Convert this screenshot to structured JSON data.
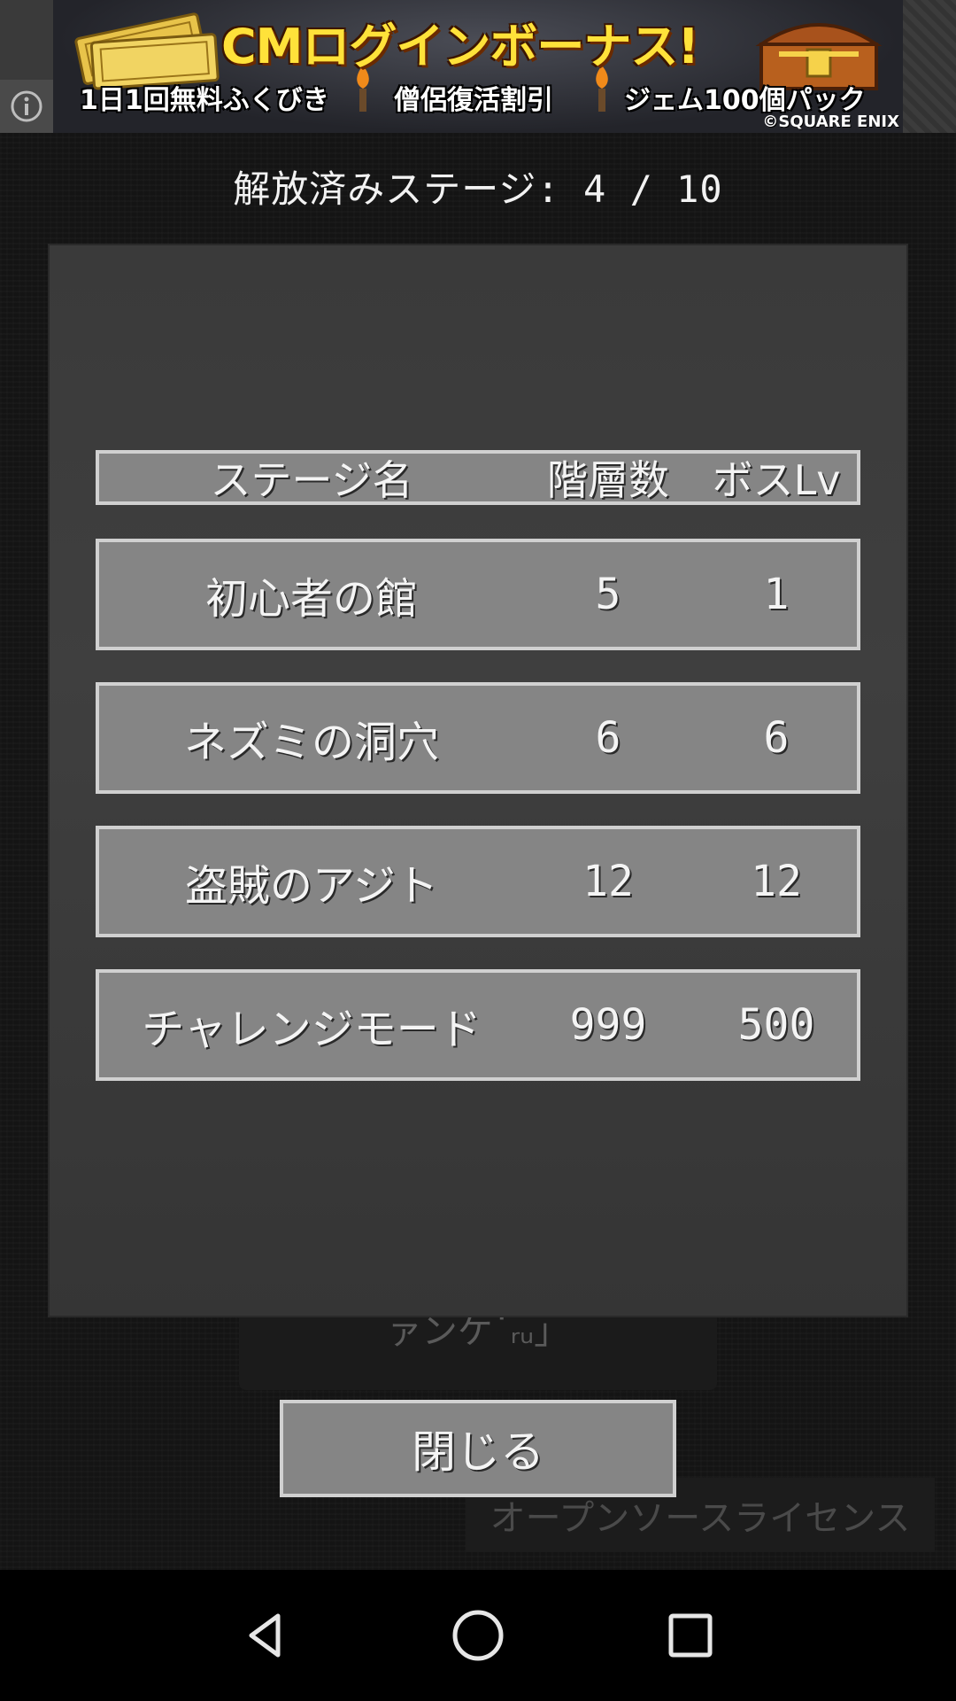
{
  "ad": {
    "title": "CMログインボーナス!",
    "items": [
      "1日1回無料ふくびき",
      "僧侶復活割引",
      "ジェム100個パック"
    ],
    "copyright": "©SQUARE ENIX",
    "info_icon": "info-icon"
  },
  "header": {
    "unlocked_label": "解放済みステージ: 4 / 10"
  },
  "table": {
    "columns": [
      "ステージ名",
      "階層数",
      "ボスLv"
    ],
    "rows": [
      {
        "name": "初心者の館",
        "floors": "5",
        "boss_lv": "1"
      },
      {
        "name": "ネズミの洞穴",
        "floors": "6",
        "boss_lv": "6"
      },
      {
        "name": "盗賊のアジト",
        "floors": "12",
        "boss_lv": "12"
      },
      {
        "name": "チャレンジモード",
        "floors": "999",
        "boss_lv": "500"
      }
    ]
  },
  "behind": {
    "partial_button_text": "ァンケ˙ᵣᵤ」",
    "license_label": "オープンソースライセンス"
  },
  "close_button": {
    "label": "閉じる"
  },
  "navbar": {
    "back_icon": "back-triangle-icon",
    "home_icon": "home-circle-icon",
    "recent_icon": "recent-square-icon"
  },
  "colors": {
    "background": "#141414",
    "panel": "#3c3c3c",
    "row_fill": "#858585",
    "row_border": "#d0d0d0",
    "ad_title": "#ffe23a"
  }
}
